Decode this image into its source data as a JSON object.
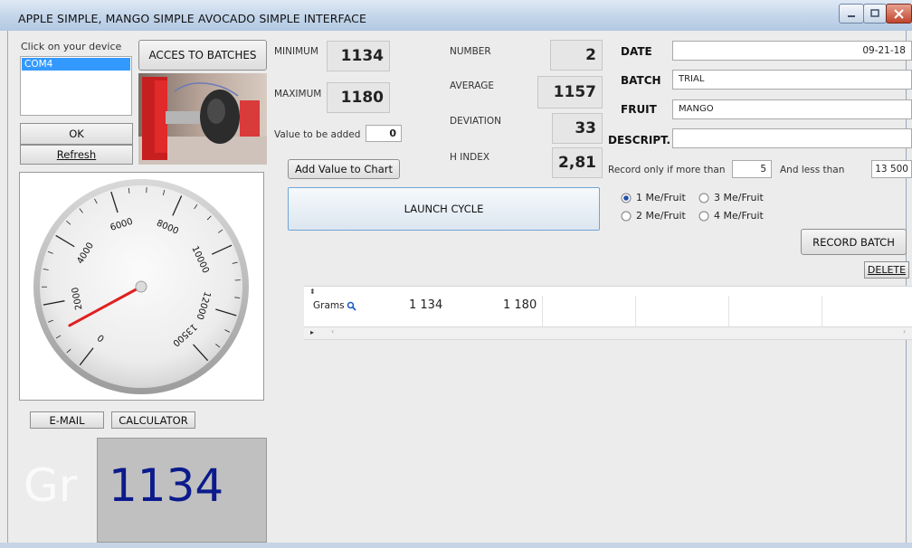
{
  "window": {
    "title": "APPLE SIMPLE, MANGO SIMPLE  AVOCADO SIMPLE INTERFACE"
  },
  "device": {
    "prompt": "Click on your device",
    "items": [
      "COM4"
    ],
    "ok_label": "OK",
    "refresh_label": "Refresh"
  },
  "batches_button": "ACCES TO BATCHES",
  "stats": {
    "minimum_label": "MINIMUM",
    "minimum": "1134",
    "maximum_label": "MAXIMUM",
    "maximum": "1180",
    "number_label": "NUMBER",
    "number": "2",
    "average_label": "AVERAGE",
    "average": "1157",
    "deviation_label": "DEVIATION",
    "deviation": "33",
    "hindex_label": "H INDEX",
    "hindex": "2,81"
  },
  "value_to_add": {
    "label": "Value to be added",
    "value": "0"
  },
  "add_value_button": "Add Value to Chart",
  "launch_button": "LAUNCH CYCLE",
  "form": {
    "date_label": "DATE",
    "date": "09-21-18",
    "batch_label": "BATCH",
    "batch": "TRIAL",
    "fruit_label": "FRUIT",
    "fruit": "MANGO",
    "descript_label": "DESCRIPT.",
    "descript": ""
  },
  "record_filter": {
    "label": "Record only if more than",
    "more_than": "5",
    "and_less_label": "And less than",
    "less_than": "13 500"
  },
  "measure_options": {
    "opt1": "1 Me/Fruit",
    "opt2": "2 Me/Fruit",
    "opt3": "3 Me/Fruit",
    "opt4": "4 Me/Fruit",
    "selected": "1 Me/Fruit"
  },
  "record_batch_button": "RECORD BATCH",
  "delete_button": "DELETE",
  "grid": {
    "row_header": "Grams",
    "values": [
      "1 134",
      "1 180"
    ]
  },
  "gauge": {
    "ticks": [
      "0",
      "2000",
      "4000",
      "6000",
      "8000",
      "10000",
      "12000",
      "13500"
    ],
    "max": 13500,
    "value": 1134
  },
  "email_button": "E-MAIL",
  "calculator_button": "CALCULATOR",
  "display": {
    "unit": "Gr",
    "value": "1134"
  }
}
